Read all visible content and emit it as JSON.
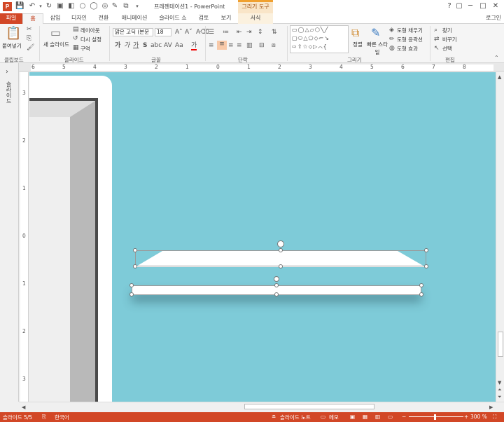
{
  "window": {
    "title": "프레젠테이션1 - PowerPoint",
    "context_tools": "그리기 도구",
    "login": "로그인",
    "help": "?"
  },
  "tabs": {
    "file": "파일",
    "home": "홈",
    "insert": "삽입",
    "design": "디자인",
    "transitions": "전환",
    "animations": "애니메이션",
    "slideshow": "슬라이드 쇼",
    "review": "검토",
    "view": "보기",
    "format": "서식"
  },
  "ribbon": {
    "clipboard": {
      "label": "클립보드",
      "paste": "붙여넣기"
    },
    "slides": {
      "label": "슬라이드",
      "new_slide": "새 슬라이드",
      "layout": "레이아웃",
      "reset": "다시 설정",
      "section": "구역"
    },
    "font": {
      "label": "글꼴",
      "font_name": "맑은 고딕 (본문",
      "font_size": "18"
    },
    "paragraph": {
      "label": "단락"
    },
    "drawing": {
      "label": "그리기",
      "arrange": "정렬",
      "quick_styles": "빠른 스타일",
      "shape_fill": "도형 채우기",
      "shape_outline": "도형 윤곽선",
      "shape_effects": "도형 효과"
    },
    "editing": {
      "label": "편집",
      "find": "찾기",
      "replace": "바꾸기",
      "select": "선택"
    }
  },
  "ruler": {
    "h_ticks": [
      "6",
      "5",
      "4",
      "3",
      "2",
      "1",
      "0",
      "1",
      "2",
      "3",
      "4",
      "5",
      "6",
      "7",
      "8"
    ],
    "v_ticks": [
      "3",
      "2",
      "1",
      "0",
      "1",
      "2",
      "3"
    ]
  },
  "left_panel": {
    "label": "슬라이드",
    "collapse_arrow": "›"
  },
  "status": {
    "slide_no": "슬라이드 5/5",
    "language": "한국어",
    "notes": "슬라이드 노트",
    "comments": "메모",
    "zoom": "300 %"
  },
  "colors": {
    "accent": "#d24726",
    "canvas": "#7ecbd8",
    "context": "#f0a030"
  }
}
